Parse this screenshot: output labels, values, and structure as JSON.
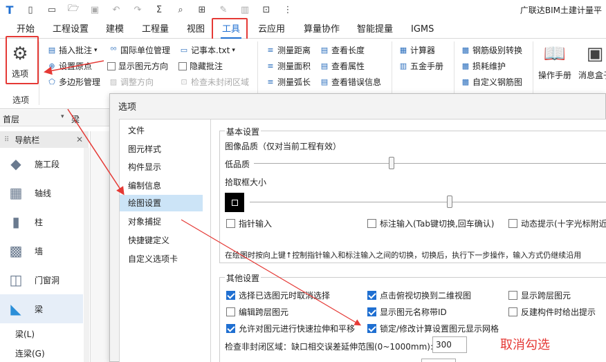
{
  "app_title": "广联达BIM土建计量平",
  "quick_access": [
    "logo-icon",
    "new-file-icon",
    "blank-icon",
    "open-icon",
    "save-icon",
    "undo-icon",
    "redo-icon",
    "sum-icon",
    "find-icon",
    "grid-search-icon",
    "pencil-icon",
    "column-icon",
    "select-icon",
    "more-icon"
  ],
  "tabs": [
    "开始",
    "工程设置",
    "建模",
    "工程量",
    "视图",
    "工具",
    "云应用",
    "算量协作",
    "智能提量",
    "IGMS"
  ],
  "active_tab": "工具",
  "ribbon": {
    "options_label": "选项",
    "options_group_label": "选项",
    "col1": [
      "插入批注",
      "设置原点",
      "多边形管理"
    ],
    "col2": [
      "国际单位管理",
      "显示图元方向",
      "调整方向"
    ],
    "col3": [
      "记事本.txt",
      "隐藏批注",
      "检查未封闭区域"
    ],
    "col4": [
      "测量距离",
      "测量面积",
      "测量弧长"
    ],
    "col5": [
      "查看长度",
      "查看属性",
      "查看错误信息"
    ],
    "col6": [
      "计算器",
      "五金手册"
    ],
    "col7": [
      "钢筋级别转换",
      "损耗维护",
      "自定义钢筋图"
    ],
    "big_btns": [
      "操作手册",
      "消息盒子"
    ]
  },
  "left": {
    "floor": "首层",
    "component": "梁",
    "nav_title": "导航栏",
    "nav_items": [
      "施工段",
      "轴线",
      "柱",
      "墙",
      "门窗洞",
      "梁"
    ],
    "sub_items": [
      "梁(L)",
      "连梁(G)"
    ]
  },
  "dialog": {
    "title": "选项",
    "nav": [
      "文件",
      "图元样式",
      "构件显示",
      "编制信息",
      "绘图设置",
      "对象捕捉",
      "快捷键定义",
      "自定义选项卡"
    ],
    "selected_nav": "绘图设置",
    "basic": {
      "legend": "基本设置",
      "image_quality": "图像品质（仅对当前工程有效）",
      "low_quality": "低品质",
      "pick_box": "拾取框大小",
      "pointer_input": "指针输入",
      "dim_input": "标注输入(Tab键切换,回车确认)",
      "dynamic_tip": "动态提示(十字光标附近",
      "description": "在绘图时按向上键↑控制指针输入和标注输入之间的切换，切换后，执行下一步操作，输入方式仍继续沿用"
    },
    "other": {
      "legend": "其他设置",
      "checkboxes": [
        {
          "label": "选择已选图元时取消选择",
          "checked": true
        },
        {
          "label": "点击俯视切换到二维视图",
          "checked": true
        },
        {
          "label": "显示跨层图元",
          "checked": false
        },
        {
          "label": "编辑跨层图元",
          "checked": false
        },
        {
          "label": "显示图元名称带ID",
          "checked": true
        },
        {
          "label": "反建构件时给出提示",
          "checked": false
        },
        {
          "label": "允许对图元进行快速拉伸和平移",
          "checked": true
        },
        {
          "label": "锁定/修改计算设置图元显示网格",
          "checked": true
        }
      ],
      "extend_label": "检查非封闭区域：缺口相交误差延伸范围(0~1000mm):",
      "extend_value": "300"
    },
    "annotation": "取消勾选"
  },
  "colors": {
    "accent": "#1f6fd1",
    "highlight": "#e53935"
  }
}
